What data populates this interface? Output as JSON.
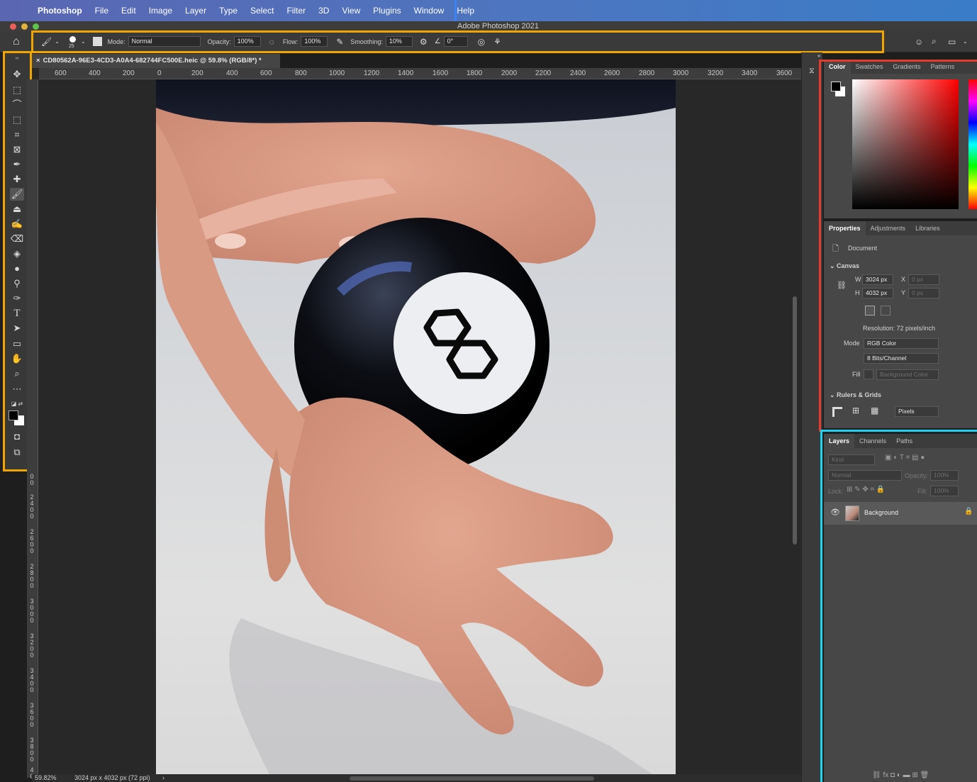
{
  "menubar": {
    "app_name": "Photoshop",
    "items": [
      "File",
      "Edit",
      "Image",
      "Layer",
      "Type",
      "Select",
      "Filter",
      "3D",
      "View",
      "Plugins",
      "Window",
      "Help"
    ]
  },
  "window": {
    "title": "Adobe Photoshop 2021"
  },
  "options_bar": {
    "brush_size": "25",
    "mode_label": "Mode:",
    "mode_value": "Normal",
    "opacity_label": "Opacity:",
    "opacity_value": "100%",
    "flow_label": "Flow:",
    "flow_value": "100%",
    "smoothing_label": "Smoothing:",
    "smoothing_value": "10%",
    "angle_value": "0°"
  },
  "document": {
    "tab_title": "CD80562A-96E3-4CD3-A0A4-682744FC500E.heic @ 59.8% (RGB/8*) *",
    "ruler_h": [
      "600",
      "400",
      "200",
      "0",
      "200",
      "400",
      "600",
      "800",
      "1000",
      "1200",
      "1400",
      "1600",
      "1800",
      "2000",
      "2200",
      "2400",
      "2600",
      "2800",
      "3000",
      "3200",
      "3400",
      "3600"
    ],
    "ruler_v": [
      "0\n0",
      "2\n4\n0\n0",
      "2\n6\n0\n0",
      "2\n8\n0\n0",
      "3\n0\n0\n0",
      "3\n2\n0\n0",
      "3\n4\n0\n0",
      "3\n6\n0\n0",
      "3\n8\n0\n0",
      "4\n0"
    ],
    "zoom": "59.82%",
    "info": "3024 px x 4032 px (72 ppi)"
  },
  "color_panel": {
    "tabs": [
      "Color",
      "Swatches",
      "Gradients",
      "Patterns"
    ],
    "hue_color": "#ff0000"
  },
  "properties_panel": {
    "tabs": [
      "Properties",
      "Adjustments",
      "Libraries"
    ],
    "doc_label": "Document",
    "canvas_heading": "Canvas",
    "w_label": "W",
    "w_value": "3024 px",
    "h_label": "H",
    "h_value": "4032 px",
    "x_label": "X",
    "x_placeholder": "0 px",
    "y_label": "Y",
    "y_placeholder": "0 px",
    "resolution": "Resolution: 72 pixels/inch",
    "mode_label": "Mode",
    "mode_value": "RGB Color",
    "bits_value": "8 Bits/Channel",
    "fill_label": "Fill",
    "fill_value": "Background Color",
    "rulers_heading": "Rulers & Grids",
    "units_value": "Pixels"
  },
  "layers_panel": {
    "tabs": [
      "Layers",
      "Channels",
      "Paths"
    ],
    "kind_placeholder": "Kind",
    "blend_value": "Normal",
    "opacity_label": "Opacity:",
    "opacity_value": "100%",
    "lock_label": "Lock:",
    "fill_label": "Fill:",
    "fill_value": "100%",
    "layer_name": "Background"
  },
  "colors": {
    "accent_blue": "#3b82f6",
    "accent_orange": "#f0a500",
    "accent_red": "#e53b2f",
    "accent_cyan": "#1ed3ee"
  }
}
